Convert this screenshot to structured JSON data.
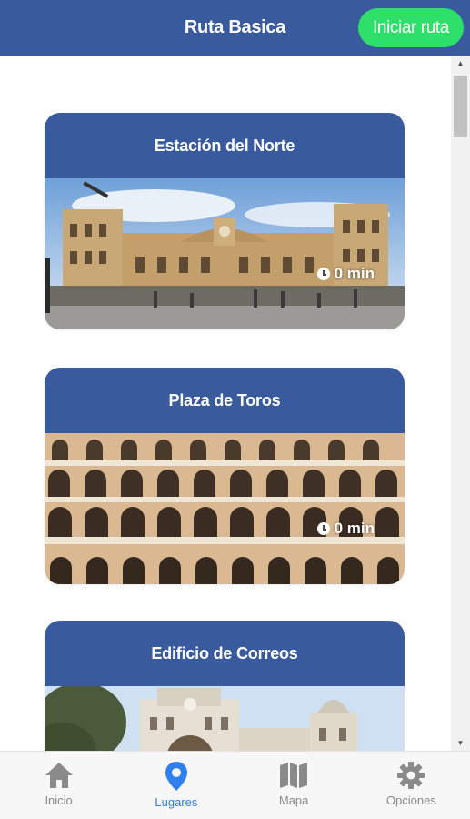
{
  "header": {
    "title": "Ruta Basica",
    "start_button": "Iniciar ruta"
  },
  "places": [
    {
      "name": "Estación del Norte",
      "time": "0 min"
    },
    {
      "name": "Plaza de Toros",
      "time": "0 min"
    },
    {
      "name": "Edificio de Correos",
      "time": ""
    }
  ],
  "tabs": [
    {
      "label": "Inicio",
      "icon": "home-icon"
    },
    {
      "label": "Lugares",
      "icon": "location-pin-icon",
      "active": true
    },
    {
      "label": "Mapa",
      "icon": "map-icon"
    },
    {
      "label": "Opciones",
      "icon": "gear-icon"
    }
  ],
  "colors": {
    "header": "#3a5a9e",
    "start_button": "#2ee06a",
    "active_tab": "#2f7fef",
    "inactive_tab": "#8a8a8a"
  }
}
